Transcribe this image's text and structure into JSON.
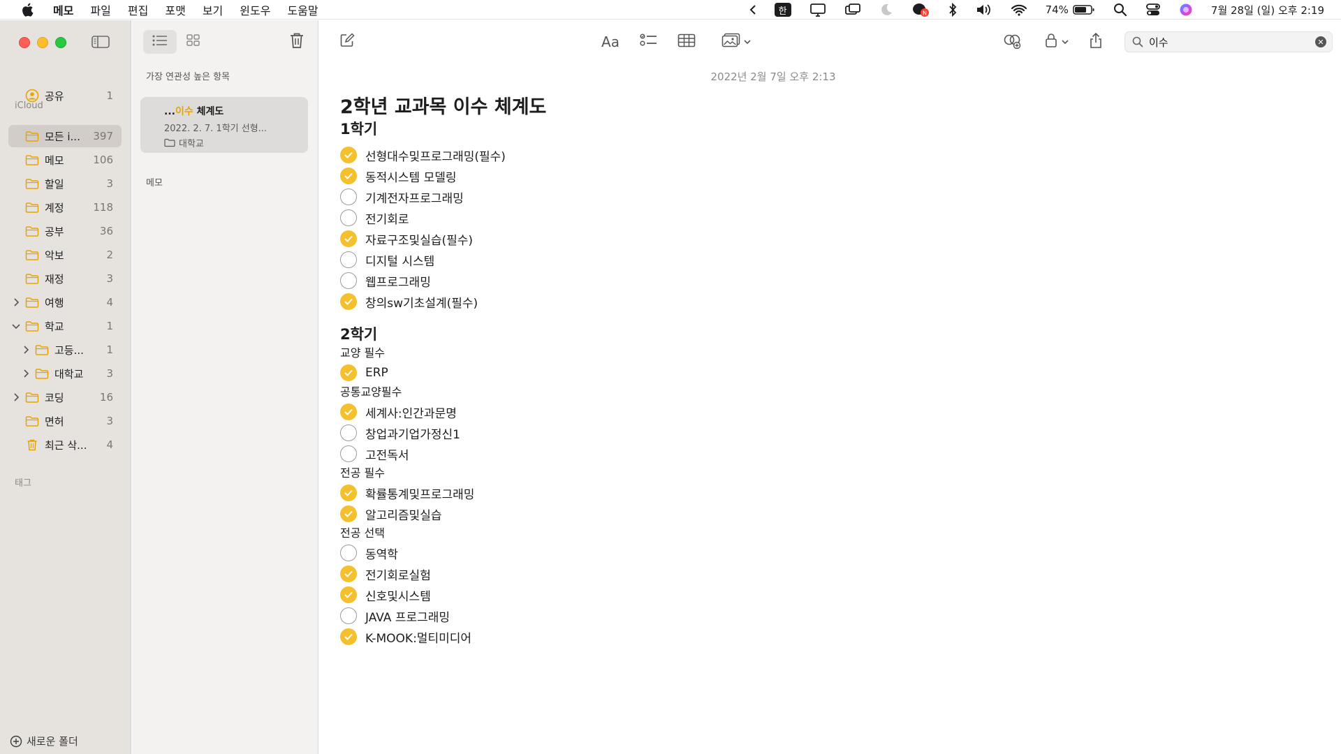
{
  "menubar": {
    "app": "메모",
    "items": [
      "파일",
      "편집",
      "포맷",
      "보기",
      "윈도우",
      "도움말"
    ],
    "ime": "한",
    "battery": "74%",
    "datetime": "7월 28일 (일) 오후 2:19",
    "badge_count": "N"
  },
  "sidebar": {
    "shared": {
      "label": "공유",
      "count": "1"
    },
    "icloud_label": "iCloud",
    "folders": [
      {
        "label": "모든 i...",
        "count": "397",
        "active": true
      },
      {
        "label": "메모",
        "count": "106"
      },
      {
        "label": "할일",
        "count": "3"
      },
      {
        "label": "계정",
        "count": "118"
      },
      {
        "label": "공부",
        "count": "36"
      },
      {
        "label": "악보",
        "count": "2"
      },
      {
        "label": "재정",
        "count": "3"
      },
      {
        "label": "여행",
        "count": "4"
      },
      {
        "label": "학교",
        "count": "1"
      },
      {
        "label": "고등...",
        "count": "1"
      },
      {
        "label": "대학교",
        "count": "3"
      },
      {
        "label": "코딩",
        "count": "16"
      },
      {
        "label": "면허",
        "count": "3"
      },
      {
        "label": "최근 삭...",
        "count": "4"
      }
    ],
    "tags_label": "태그",
    "new_folder": "새로운 폴더"
  },
  "notelist": {
    "top_hits_label": "가장 연관성 높은 항목",
    "card": {
      "title_prefix": "...",
      "title_highlight": "이수",
      "title_rest": " 체계도",
      "meta": "2022. 2. 7.   1학기 선형...",
      "folder": "대학교"
    },
    "notes_label": "메모"
  },
  "editor": {
    "format_label": "Aa",
    "search_value": "이수",
    "date": "2022년 2월 7일 오후 2:13",
    "title": "2학년 교과목 이수 체계도",
    "sem1": {
      "heading": "1학기",
      "items": [
        {
          "text": "선형대수및프로그래밍(필수)",
          "checked": true
        },
        {
          "text": "동적시스템 모델링",
          "checked": true
        },
        {
          "text": "기계전자프로그래밍",
          "checked": false
        },
        {
          "text": "전기회로",
          "checked": false
        },
        {
          "text": "자료구조및실습(필수)",
          "checked": true
        },
        {
          "text": "디지털 시스템",
          "checked": false
        },
        {
          "text": "웹프로그래밍",
          "checked": false
        },
        {
          "text": "창의sw기초설계(필수)",
          "checked": true
        }
      ]
    },
    "sem2": {
      "heading": "2학기",
      "groups": [
        {
          "label": "교양 필수",
          "items": [
            {
              "text": "ERP",
              "checked": true
            }
          ]
        },
        {
          "label": "공통교양필수",
          "items": [
            {
              "text": "세계사:인간과문명",
              "checked": true
            },
            {
              "text": "창업과기업가정신1",
              "checked": false
            },
            {
              "text": "고전독서",
              "checked": false
            }
          ]
        },
        {
          "label": "전공 필수",
          "items": [
            {
              "text": "확률통계및프로그래밍",
              "checked": true
            },
            {
              "text": "알고리즘및실습",
              "checked": true
            }
          ]
        },
        {
          "label": "전공 선택",
          "items": [
            {
              "text": "동역학",
              "checked": false
            },
            {
              "text": "전기회로실험",
              "checked": true
            },
            {
              "text": "신호및시스템",
              "checked": true
            },
            {
              "text": "JAVA 프로그래밍",
              "checked": false
            },
            {
              "text": "K-MOOK:멀티미디어",
              "checked": true
            }
          ]
        }
      ]
    }
  },
  "colors": {
    "accent": "#f4c02e",
    "folder": "#e8a300"
  }
}
